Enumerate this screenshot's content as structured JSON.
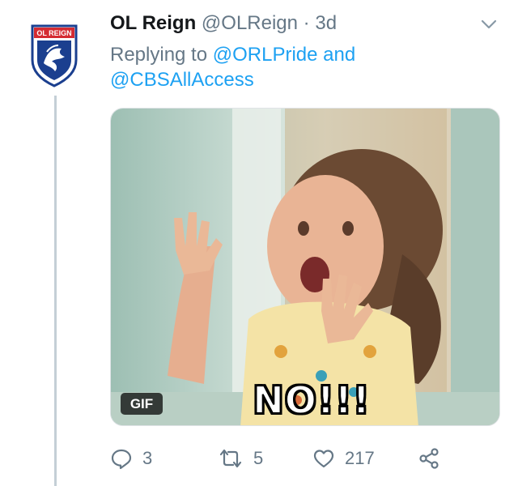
{
  "tweet": {
    "display_name": "OL Reign",
    "handle": "@OLReign",
    "separator": "·",
    "time": "3d",
    "reply_prefix": "Replying to",
    "mention_1": "@ORLPride",
    "reply_and": "and",
    "mention_2": "@CBSAllAccess",
    "avatar_logo_text": "OL REIGN"
  },
  "media": {
    "badge": "GIF",
    "caption": "NO!!!"
  },
  "actions": {
    "reply_count": "3",
    "retweet_count": "5",
    "like_count": "217"
  },
  "colors": {
    "link": "#1da1f2",
    "secondary_text": "#657786",
    "thread_line": "#c4cfd6",
    "logo_blue": "#1b3f8f",
    "logo_red": "#d42b32"
  },
  "icons": {
    "caret": "chevron-down-icon",
    "reply": "reply-icon",
    "retweet": "retweet-icon",
    "like": "heart-icon",
    "share": "share-icon"
  }
}
